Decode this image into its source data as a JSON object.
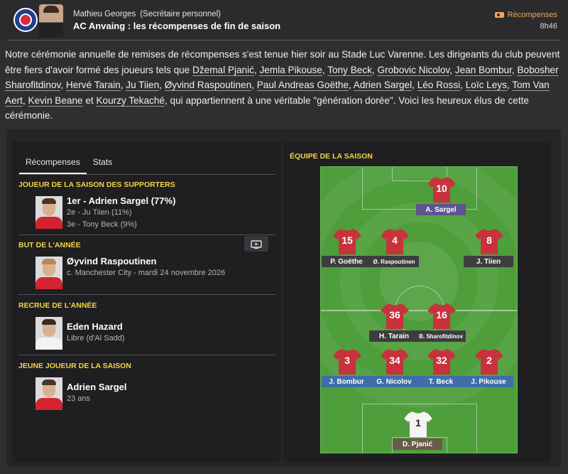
{
  "header": {
    "sender_name": "Mathieu Georges",
    "sender_role": "(Secrétaire personnel)",
    "title": "AC Anvaing : les récompenses de fin de saison",
    "tag_label": "Récompenses",
    "time": "8h46",
    "club_logo_icon": "club-crest-icon",
    "accent_color": "#f2a55a"
  },
  "intro": {
    "part1": "Notre cérémonie annuelle de remises de récompenses s'est tenue hier soir au Stade Luc Varenne. Les dirigeants du club peuvent être fiers d'avoir formé des joueurs tels que ",
    "players": [
      "Džemal Pjanić",
      "Jemla Pikouse",
      "Tony Beck",
      "Grobovic Nicolov",
      "Jean Bombur",
      "Bobosher Sharofitdinov",
      "Hervé Tarain",
      "Ju Tiien",
      "Øyvind Raspoutinen",
      "Paul Andreas Goëthe",
      "Adrien Sargel",
      "Léo Rossi",
      "Loïc Leys",
      "Tom Van Aert",
      "Kevin Beane",
      "Kourzy Tekaché"
    ],
    "part2": ", qui appartiennent à une véritable \"génération dorée\". Voici les heureux élus de cette cérémonie."
  },
  "tabs": [
    "Récompenses",
    "Stats"
  ],
  "awards": {
    "supporters": {
      "title": "JOUEUR DE LA SAISON DES SUPPORTERS",
      "first": "1er - Adrien Sargel (77%)",
      "second": "2e - Ju Tiien (11%)",
      "third": "3e - Tony Beck (9%)"
    },
    "goal": {
      "title": "BUT DE L'ANNÉE",
      "player": "Øyvind Raspoutinen",
      "detail": "c. Manchester City - mardi 24 novembre 2026",
      "video_icon": "tv-play-icon"
    },
    "signing": {
      "title": "RECRUE DE L'ANNÉE",
      "player": "Eden Hazard",
      "detail": "Libre (d'Al Sadd)"
    },
    "young": {
      "title": "JEUNE JOUEUR DE LA SAISON",
      "player": "Adrien Sargel",
      "detail": "23 ans"
    }
  },
  "team": {
    "title": "ÉQUIPE DE LA SAISON",
    "players": [
      {
        "number": "10",
        "name": "A. Sargel",
        "color": "purple"
      },
      {
        "number": "15",
        "name": "P. Goëthe",
        "color": "grey"
      },
      {
        "number": "4",
        "name": "Ø. Raspoutinen",
        "color": "grey"
      },
      {
        "number": "8",
        "name": "J. Tiien",
        "color": "grey"
      },
      {
        "number": "36",
        "name": "H. Tarain",
        "color": "grey"
      },
      {
        "number": "16",
        "name": "B. Sharofitdinov",
        "color": "grey"
      },
      {
        "number": "3",
        "name": "J. Bombur",
        "color": "blue"
      },
      {
        "number": "34",
        "name": "G. Nicolov",
        "color": "blue"
      },
      {
        "number": "32",
        "name": "T. Beck",
        "color": "blue"
      },
      {
        "number": "2",
        "name": "J. Pikouse",
        "color": "blue"
      },
      {
        "number": "1",
        "name": "D. Pjanić",
        "color": "brown"
      }
    ]
  }
}
